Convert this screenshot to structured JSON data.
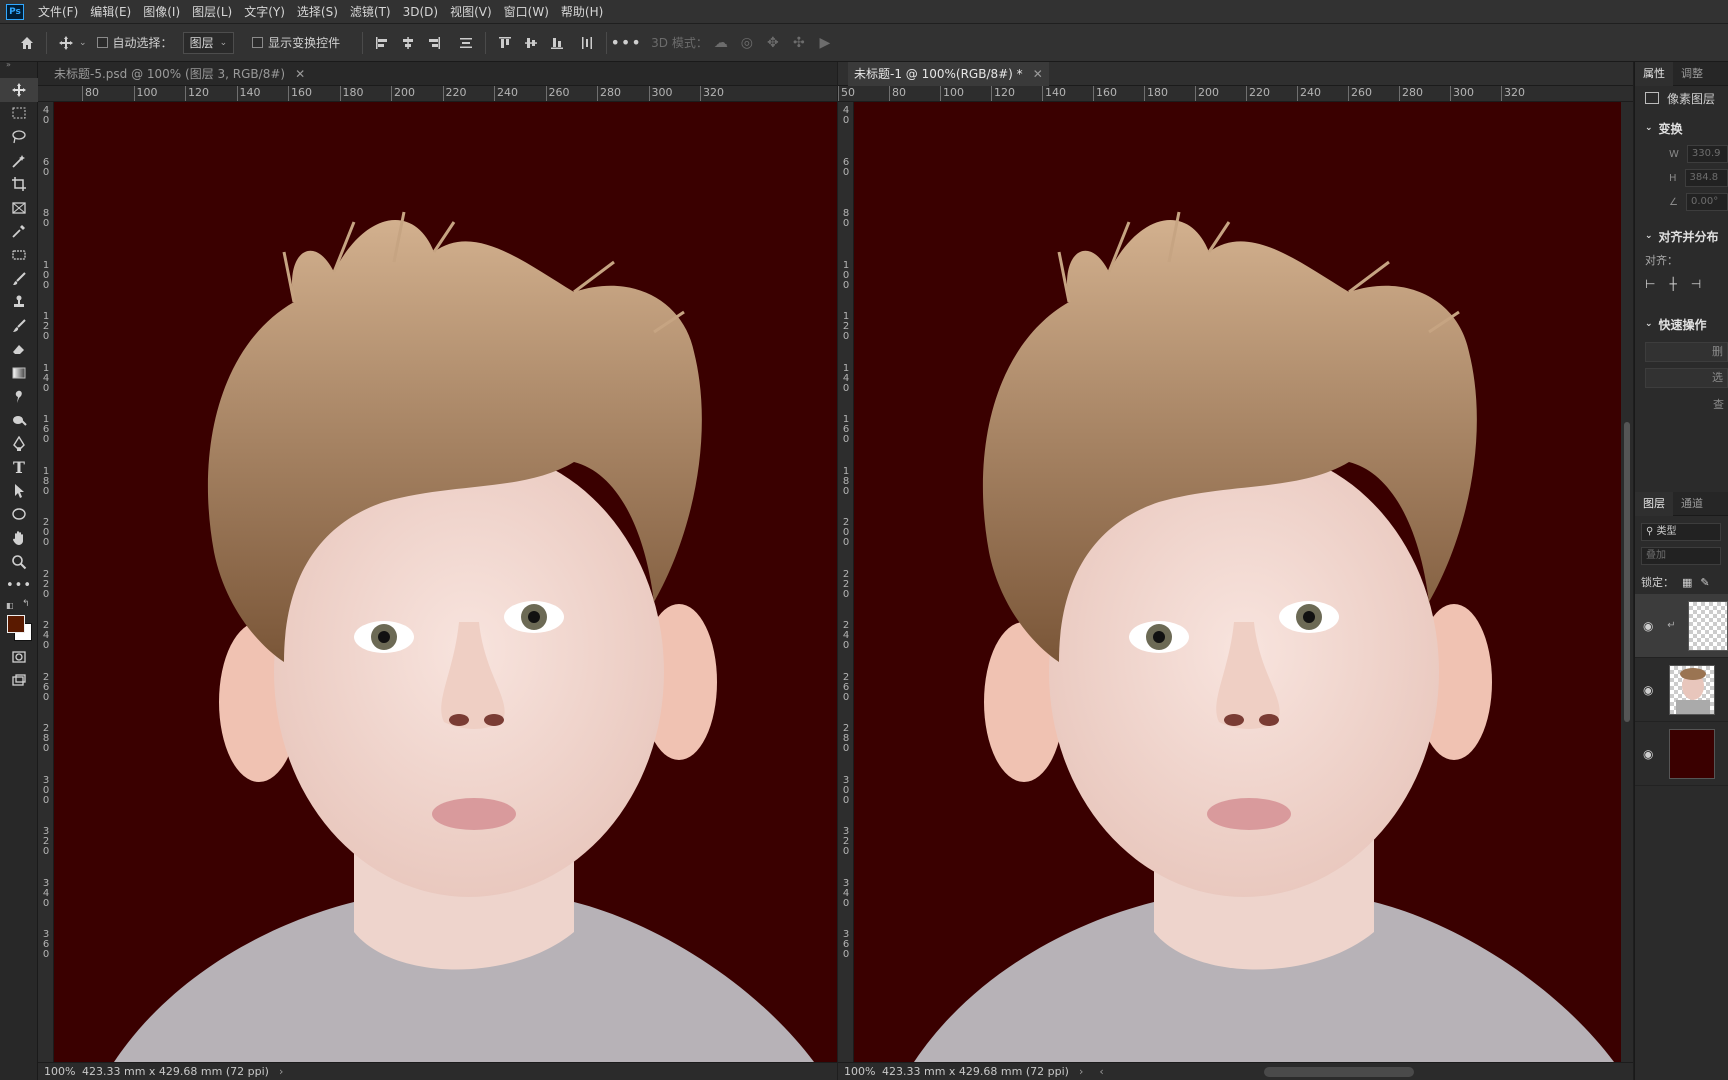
{
  "app": {
    "logo": "Ps"
  },
  "menu": [
    "文件(F)",
    "编辑(E)",
    "图像(I)",
    "图层(L)",
    "文字(Y)",
    "选择(S)",
    "滤镜(T)",
    "3D(D)",
    "视图(V)",
    "窗口(W)",
    "帮助(H)"
  ],
  "options": {
    "auto_select_label": "自动选择：",
    "auto_select_value": "图层",
    "show_transform_label": "显示变换控件",
    "mode_3d_label": "3D 模式："
  },
  "colors": {
    "canvas_bg": "#3a0000",
    "foreground": "#5a1a00",
    "background": "#ffffff",
    "accent": "#31a8ff"
  },
  "documents": [
    {
      "tab_title": "未标题-5.psd @ 100% (图层 3, RGB/8#)",
      "zoom": "100%",
      "size": "423.33 mm x 429.68 mm (72 ppi)",
      "ruler_h": [
        "80",
        "100",
        "120",
        "140",
        "160",
        "180",
        "200",
        "220",
        "240",
        "260",
        "280",
        "300",
        "320"
      ],
      "ruler_v": [
        "4\n0",
        "6\n0",
        "8\n0",
        "1\n0\n0",
        "1\n2\n0",
        "1\n4\n0",
        "1\n6\n0",
        "1\n8\n0",
        "2\n0\n0",
        "2\n2\n0",
        "2\n4\n0",
        "2\n6\n0",
        "2\n8\n0",
        "3\n0\n0",
        "3\n2\n0",
        "3\n4\n0",
        "3\n6\n0"
      ]
    },
    {
      "tab_title": "未标题-1 @ 100%(RGB/8#) *",
      "zoom": "100%",
      "size": "423.33 mm x 429.68 mm (72 ppi)",
      "ruler_h": [
        "50",
        "80",
        "100",
        "120",
        "140",
        "160",
        "180",
        "200",
        "220",
        "240",
        "260",
        "280",
        "300",
        "320"
      ],
      "ruler_v": [
        "4\n0",
        "6\n0",
        "8\n0",
        "1\n0\n0",
        "1\n2\n0",
        "1\n4\n0",
        "1\n6\n0",
        "1\n8\n0",
        "2\n0\n0",
        "2\n2\n0",
        "2\n4\n0",
        "2\n6\n0",
        "2\n8\n0",
        "3\n0\n0",
        "3\n2\n0",
        "3\n4\n0",
        "3\n6\n0"
      ]
    }
  ],
  "properties": {
    "tabs": [
      "属性",
      "调整"
    ],
    "pixel_layer_label": "像素图层",
    "transform_title": "变换",
    "w_label": "W",
    "w_value": "330.9",
    "h_label": "H",
    "h_value": "384.8",
    "angle_value": "0.00°",
    "align_title": "对齐并分布",
    "align_label": "对齐：",
    "quick_title": "快速操作",
    "quick_btn1": "删",
    "quick_btn2": "选",
    "quick_btn3": "查"
  },
  "layers_panel": {
    "tabs": [
      "图层",
      "通道"
    ],
    "filter_label": "类型",
    "blend_mode": "叠加",
    "lock_label": "锁定："
  },
  "tool_icons": [
    "move-icon",
    "marquee-icon",
    "lasso-icon",
    "magic-wand-icon",
    "crop-icon",
    "frame-icon",
    "eyedropper-icon",
    "patch-icon",
    "brush-icon",
    "stamp-icon",
    "history-brush-icon",
    "eraser-icon",
    "gradient-icon",
    "smudge-icon",
    "dodge-icon",
    "pen-icon",
    "type-icon",
    "path-select-icon",
    "ellipse-icon",
    "hand-icon",
    "zoom-icon",
    "more-icon"
  ]
}
